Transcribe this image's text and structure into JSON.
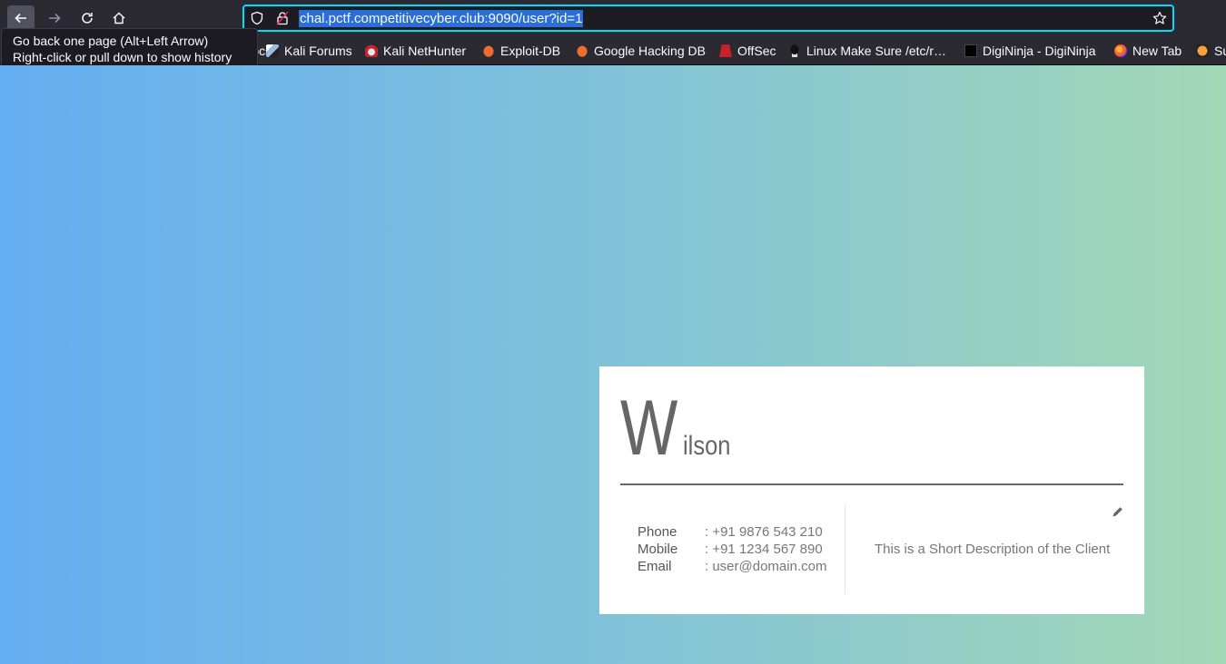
{
  "browser": {
    "url": "chal.pctf.competitivecyber.club:9090/user?id=1",
    "tooltip_line1": "Go back one page (Alt+Left Arrow)",
    "tooltip_line2": "Right-click or pull down to show history",
    "partial_bookmark": "Kali Docs"
  },
  "bookmarks": [
    {
      "label": "Kali Forums",
      "icon": "kali-dragon-icon"
    },
    {
      "label": "Kali NetHunter",
      "icon": "nethunter-icon"
    },
    {
      "label": "Exploit-DB",
      "icon": "exploit-db-icon"
    },
    {
      "label": "Google Hacking DB",
      "icon": "exploit-db-icon"
    },
    {
      "label": "OffSec",
      "icon": "offsec-icon"
    },
    {
      "label": "Linux Make Sure /etc/r…",
      "icon": "penguin-icon"
    },
    {
      "label": "DigiNinja - DigiNinja",
      "icon": "ninja-icon"
    },
    {
      "label": "New Tab",
      "icon": "firefox-icon"
    },
    {
      "label": "Su",
      "icon": "tiger-icon"
    }
  ],
  "card": {
    "name_initial": "W",
    "name_rest": "ilson",
    "phone_label": "Phone",
    "phone_value": ": +91 9876 543 210",
    "mobile_label": "Mobile",
    "mobile_value": ": +91 1234 567 890",
    "email_label": "Email",
    "email_value": ": user@domain.com",
    "description": "This is a Short Description of the Client"
  }
}
